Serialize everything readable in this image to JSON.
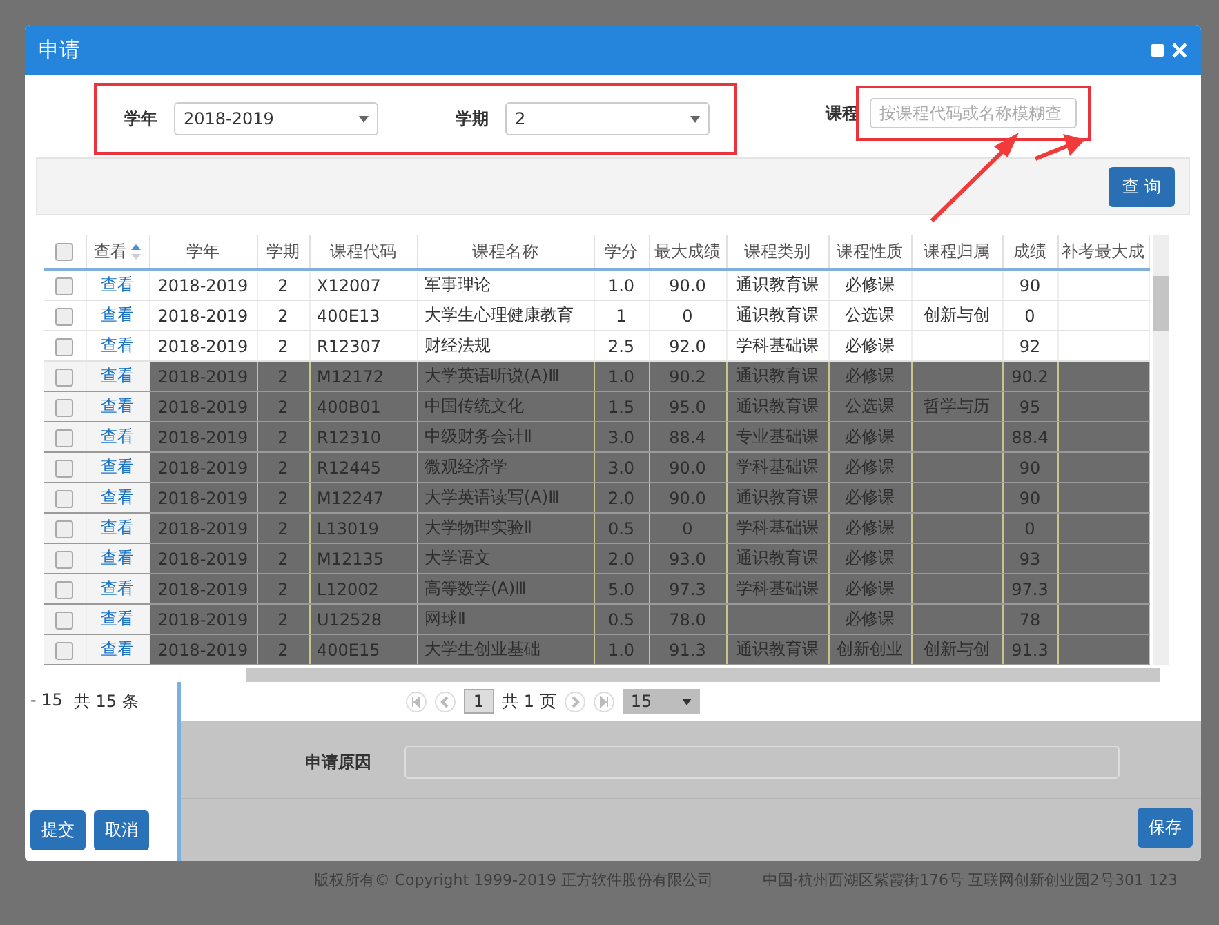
{
  "dialog": {
    "title": "申请"
  },
  "filter": {
    "year_label": "学年",
    "year_value": "2018-2019",
    "term_label": "学期",
    "term_value": "2",
    "course_label": "课程",
    "course_placeholder": "按课程代码或名称模糊查"
  },
  "query_button": "查 询",
  "table": {
    "select_all_checked": false,
    "columns": [
      "查看",
      "学年",
      "学期",
      "课程代码",
      "课程名称",
      "学分",
      "最大成绩",
      "课程类别",
      "课程性质",
      "课程归属",
      "成绩",
      "补考最大成"
    ],
    "rows": [
      {
        "view": "查看",
        "year": "2018-2019",
        "term": "2",
        "code": "X12007",
        "name": "军事理论",
        "credit": "1.0",
        "max": "90.0",
        "category": "通识教育课",
        "nature": "必修课",
        "score": "90",
        "checked": false,
        "dimmed": false
      },
      {
        "view": "查看",
        "year": "2018-2019",
        "term": "2",
        "code": "400E13",
        "name": "大学生心理健康教育",
        "credit": "1",
        "max": "0",
        "category": "通识教育课",
        "nature": "公选课",
        "belong": "创新与创",
        "score": "0",
        "checked": false,
        "dimmed": false
      },
      {
        "view": "查看",
        "year": "2018-2019",
        "term": "2",
        "code": "R12307",
        "name": "财经法规",
        "credit": "2.5",
        "max": "92.0",
        "category": "学科基础课",
        "nature": "必修课",
        "score": "92",
        "checked": false,
        "dimmed": false
      },
      {
        "view": "查看",
        "year": "2018-2019",
        "term": "2",
        "code": "M12172",
        "name": "大学英语听说(A)Ⅲ",
        "credit": "1.0",
        "max": "90.2",
        "category": "通识教育课",
        "nature": "必修课",
        "score": "90.2",
        "checked": false,
        "dimmed": true
      },
      {
        "view": "查看",
        "year": "2018-2019",
        "term": "2",
        "code": "400B01",
        "name": "中国传统文化",
        "credit": "1.5",
        "max": "95.0",
        "category": "通识教育课",
        "nature": "公选课",
        "belong": "哲学与历",
        "score": "95",
        "checked": false,
        "dimmed": true
      },
      {
        "view": "查看",
        "year": "2018-2019",
        "term": "2",
        "code": "R12310",
        "name": "中级财务会计Ⅱ",
        "credit": "3.0",
        "max": "88.4",
        "category": "专业基础课",
        "nature": "必修课",
        "score": "88.4",
        "checked": false,
        "dimmed": true
      },
      {
        "view": "查看",
        "year": "2018-2019",
        "term": "2",
        "code": "R12445",
        "name": "微观经济学",
        "credit": "3.0",
        "max": "90.0",
        "category": "学科基础课",
        "nature": "必修课",
        "score": "90",
        "checked": false,
        "dimmed": true
      },
      {
        "view": "查看",
        "year": "2018-2019",
        "term": "2",
        "code": "M12247",
        "name": "大学英语读写(A)Ⅲ",
        "credit": "2.0",
        "max": "90.0",
        "category": "通识教育课",
        "nature": "必修课",
        "score": "90",
        "checked": false,
        "dimmed": true
      },
      {
        "view": "查看",
        "year": "2018-2019",
        "term": "2",
        "code": "L13019",
        "name": "大学物理实验Ⅱ",
        "credit": "0.5",
        "max": "0",
        "category": "学科基础课",
        "nature": "必修课",
        "score": "0",
        "checked": false,
        "dimmed": true
      },
      {
        "view": "查看",
        "year": "2018-2019",
        "term": "2",
        "code": "M12135",
        "name": "大学语文",
        "credit": "2.0",
        "max": "93.0",
        "category": "通识教育课",
        "nature": "必修课",
        "score": "93",
        "checked": false,
        "dimmed": true
      },
      {
        "view": "查看",
        "year": "2018-2019",
        "term": "2",
        "code": "L12002",
        "name": "高等数学(A)Ⅲ",
        "credit": "5.0",
        "max": "97.3",
        "category": "学科基础课",
        "nature": "必修课",
        "score": "97.3",
        "checked": false,
        "dimmed": true
      },
      {
        "view": "查看",
        "year": "2018-2019",
        "term": "2",
        "code": "U12528",
        "name": "网球Ⅱ",
        "credit": "0.5",
        "max": "78.0",
        "nature": "必修课",
        "score": "78",
        "checked": false,
        "dimmed": true
      },
      {
        "view": "查看",
        "year": "2018-2019",
        "term": "2",
        "code": "400E15",
        "name": "大学生创业基础",
        "credit": "1.0",
        "max": "91.3",
        "category": "通识教育课",
        "nature": "创新创业",
        "belong": "创新与创",
        "score": "91.3",
        "checked": false,
        "dimmed": true
      }
    ]
  },
  "side_panel": {
    "range": "- 15",
    "total": "共 15 条",
    "buttons": [
      "提交",
      "取消"
    ]
  },
  "pager": {
    "page": "1",
    "pages": "共 1 页",
    "size": "15"
  },
  "reason": {
    "label": "申请原因"
  },
  "save_button": "保存",
  "footer": {
    "copyright": "版权所有© Copyright 1999-2019 正方软件股份有限公司",
    "address": "中国·杭州西湖区紫霞街176号 互联网创新创业园2号301 123"
  }
}
